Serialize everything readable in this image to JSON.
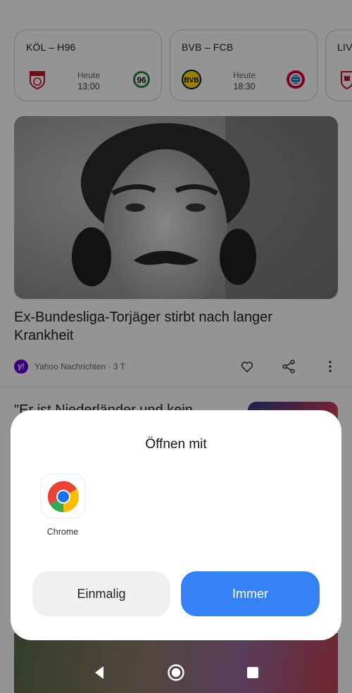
{
  "scores": [
    {
      "teams": "KÖL – H96",
      "day": "Heute",
      "time": "13:00",
      "home_crest": "fc-koeln-crest",
      "away_crest": "hannover-96-crest"
    },
    {
      "teams": "BVB – FCB",
      "day": "Heute",
      "time": "18:30",
      "home_crest": "bvb-crest",
      "away_crest": "fc-bayern-crest"
    },
    {
      "teams": "LIV",
      "home_crest": "liverpool-crest"
    }
  ],
  "article": {
    "headline": "Ex-Bundesliga-Torjäger stirbt nach langer Krankheit",
    "source": "Yahoo Nachrichten · 3 T",
    "source_logo": "y!",
    "image": "black-and-white-portrait-photo"
  },
  "article2": {
    "headline": "\"Er ist Niederländer und kein"
  },
  "dialog": {
    "title": "Öffnen mit",
    "app_name": "Chrome",
    "once_label": "Einmalig",
    "always_label": "Immer"
  },
  "colors": {
    "accent": "#3482f6",
    "secondary_button": "#f0f0f0",
    "scrim": "rgba(0,0,0,0.42)"
  },
  "navbar": {
    "icons": [
      "back-icon",
      "home-icon",
      "recents-icon"
    ]
  }
}
